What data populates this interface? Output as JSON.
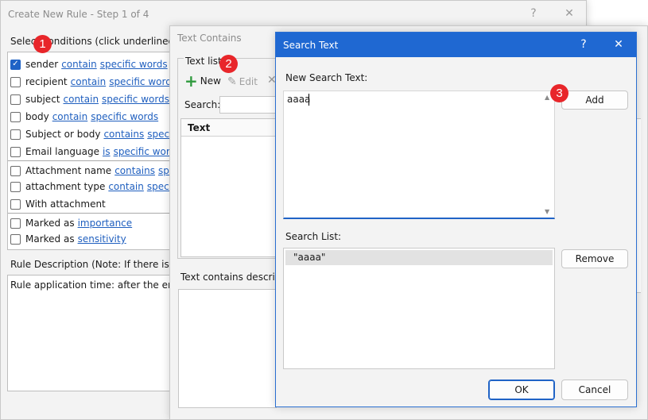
{
  "win1": {
    "title": "Create New Rule - Step 1 of 4",
    "help": "?",
    "close": "✕",
    "section_label": "Select conditions (click underlined valu",
    "conditions": [
      {
        "checked": true,
        "pre": "sender",
        "links": [
          "contain",
          "specific words"
        ]
      },
      {
        "checked": false,
        "pre": "recipient",
        "links": [
          "contain",
          "specific words"
        ]
      },
      {
        "checked": false,
        "pre": "subject",
        "links": [
          "contain",
          "specific words"
        ]
      },
      {
        "checked": false,
        "pre": "body",
        "links": [
          "contain",
          "specific words"
        ]
      },
      {
        "checked": false,
        "pre": "Subject or body",
        "links": [
          "contains",
          "specific wo"
        ]
      },
      {
        "checked": false,
        "pre": "Email language",
        "links": [
          "is",
          "specific words"
        ]
      },
      {
        "checked": false,
        "pre": "Attachment name",
        "links": [
          "contains",
          "specific"
        ]
      },
      {
        "checked": false,
        "pre": "attachment type",
        "links": [
          "contain",
          "specific w"
        ]
      },
      {
        "checked": false,
        "pre": "With attachment",
        "links": []
      },
      {
        "checked": false,
        "pre": "Marked as",
        "links": [
          "importance"
        ]
      },
      {
        "checked": false,
        "pre": "Marked as",
        "links": [
          "sensitivity"
        ]
      }
    ],
    "desc_label": "Rule Description (Note: If there is a co",
    "desc_text": "Rule application time: after the email a"
  },
  "win2": {
    "title": "Text Contains",
    "group_label": "Text list",
    "new_label": "New",
    "edit_label": "Edit",
    "search_label": "Search:",
    "col_text": "Text",
    "desc_label": "Text contains descripti"
  },
  "win3": {
    "title": "Search Text",
    "help": "?",
    "close": "✕",
    "new_label": "New Search Text:",
    "new_value": "aaaa",
    "add_label": "Add",
    "list_label": "Search List:",
    "list_items": [
      "\"aaaa\""
    ],
    "remove_label": "Remove",
    "ok_label": "OK",
    "cancel_label": "Cancel"
  },
  "badges": [
    "1",
    "2",
    "3"
  ],
  "colors": {
    "accent": "#1f63c6",
    "link": "#1f5fbf",
    "badge": "#e8262a"
  }
}
